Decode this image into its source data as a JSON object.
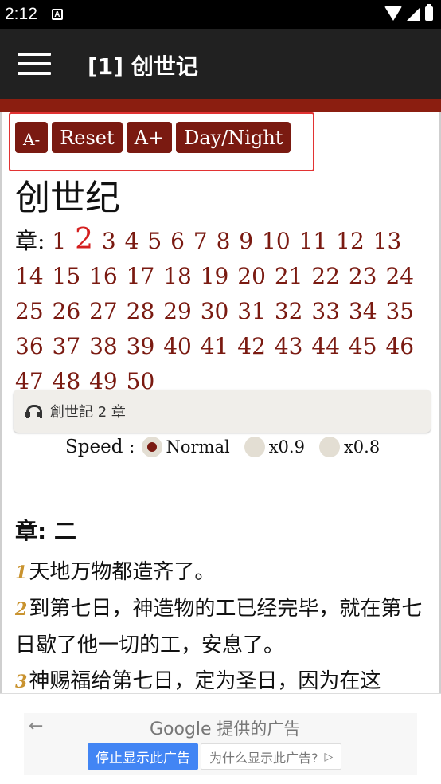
{
  "status_bar": {
    "time": "2:12",
    "notification_letter": "A"
  },
  "app_bar": {
    "title": "[1] 创世记"
  },
  "toolbar": {
    "decrease_label": "A-",
    "reset_label": "Reset",
    "increase_label": "A+",
    "theme_label": "Day/Night"
  },
  "book_title": "创世纪",
  "chapter_nav": {
    "label": "章:",
    "current": 2,
    "chapters": [
      "1",
      "2",
      "3",
      "4",
      "5",
      "6",
      "7",
      "8",
      "9",
      "10",
      "11",
      "12",
      "13",
      "14",
      "15",
      "16",
      "17",
      "18",
      "19",
      "20",
      "21",
      "22",
      "23",
      "24",
      "25",
      "26",
      "27",
      "28",
      "29",
      "30",
      "31",
      "32",
      "33",
      "34",
      "35",
      "36",
      "37",
      "38",
      "39",
      "40",
      "41",
      "42",
      "43",
      "44",
      "45",
      "46",
      "47",
      "48",
      "49",
      "50"
    ]
  },
  "audio": {
    "label": "創世記 2 章"
  },
  "speed": {
    "label": "Speed :",
    "options": [
      {
        "label": "Normal",
        "checked": true
      },
      {
        "label": "x0.9",
        "checked": false
      },
      {
        "label": "x0.8",
        "checked": false
      }
    ]
  },
  "chapter_heading": "章: 二",
  "verses": [
    {
      "num": "1",
      "text": "天地万物都造齐了。"
    },
    {
      "num": "2",
      "text": "到第七日，神造物的工已经完毕，就在第七日歇了他一切的工，安息了。"
    },
    {
      "num": "3",
      "text": "神赐福给第七日，定为圣日，因为在这"
    }
  ],
  "ad": {
    "back_icon": "arrow-left-icon",
    "provider_logo": "Google",
    "provider_text": "提供的广告",
    "stop_label": "停止显示此广告",
    "why_label": "为什么显示此广告?"
  },
  "colors": {
    "accent": "#7a1a11",
    "current_chapter": "#d41f1f",
    "verse_num": "#c9932f",
    "app_bar": "#212121"
  }
}
